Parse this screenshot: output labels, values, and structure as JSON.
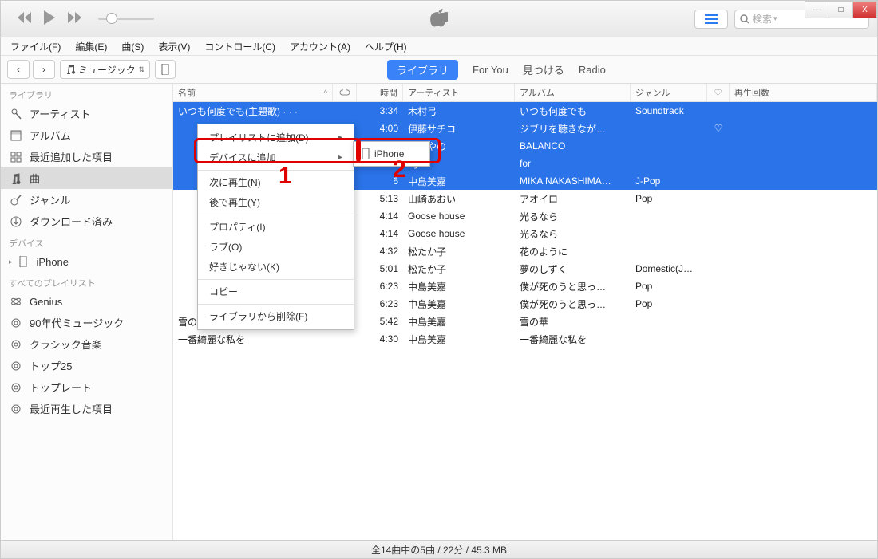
{
  "window_controls": {
    "minimize": "—",
    "maximize": "□",
    "close": "X"
  },
  "menubar": [
    "ファイル(F)",
    "編集(E)",
    "曲(S)",
    "表示(V)",
    "コントロール(C)",
    "アカウント(A)",
    "ヘルプ(H)"
  ],
  "search": {
    "placeholder": "検索"
  },
  "media_selector": {
    "label": "ミュージック",
    "chev": "▾"
  },
  "nav_tabs": {
    "library": "ライブラリ",
    "forYou": "For You",
    "browse": "見つける",
    "radio": "Radio"
  },
  "sidebar": {
    "library_header": "ライブラリ",
    "library_items": [
      {
        "key": "artist",
        "label": "アーティスト"
      },
      {
        "key": "album",
        "label": "アルバム"
      },
      {
        "key": "recent",
        "label": "最近追加した項目"
      },
      {
        "key": "songs",
        "label": "曲",
        "selected": true
      },
      {
        "key": "genre",
        "label": "ジャンル"
      },
      {
        "key": "downloaded",
        "label": "ダウンロード済み"
      }
    ],
    "devices_header": "デバイス",
    "devices": [
      {
        "label": "iPhone"
      }
    ],
    "playlists_header": "すべてのプレイリスト",
    "playlists": [
      {
        "label": "Genius"
      },
      {
        "label": "90年代ミュージック"
      },
      {
        "label": "クラシック音楽"
      },
      {
        "label": "トップ25"
      },
      {
        "label": "トップレート"
      },
      {
        "label": "最近再生した項目"
      }
    ]
  },
  "columns": {
    "name": "名前",
    "time": "時間",
    "artist": "アーティスト",
    "album": "アルバム",
    "genre": "ジャンル",
    "plays": "再生回数"
  },
  "tracks": [
    {
      "sel": true,
      "name": "いつも何度でも(主題歌) · · ·",
      "time": "3:34",
      "artist": "木村弓",
      "album": "いつも何度でも",
      "genre": "Soundtrack"
    },
    {
      "sel": true,
      "name": "",
      "time": "4:00",
      "artist": "伊藤サチコ",
      "album": "ジブリを聴きなが…",
      "genre": "",
      "heart": "♡"
    },
    {
      "sel": true,
      "name": "",
      "time": "",
      "artist": "じあやの",
      "album": "BALANCO",
      "genre": ""
    },
    {
      "sel": true,
      "name": "",
      "time": "",
      "artist": "円",
      "album": "for",
      "genre": ""
    },
    {
      "sel": true,
      "name": "",
      "time": "6",
      "artist": "中島美嘉",
      "album": "MIKA NAKASHIMA…",
      "genre": "J-Pop"
    },
    {
      "sel": false,
      "name": "",
      "time": "5:13",
      "artist": "山崎あおい",
      "album": "アオイロ",
      "genre": "Pop"
    },
    {
      "sel": false,
      "name": "",
      "time": "4:14",
      "artist": "Goose house",
      "album": "光るなら",
      "genre": ""
    },
    {
      "sel": false,
      "name": "",
      "time": "4:14",
      "artist": "Goose house",
      "album": "光るなら",
      "genre": "",
      "ex": true
    },
    {
      "sel": false,
      "name": "",
      "time": "4:32",
      "artist": "松たか子",
      "album": "花のように",
      "genre": ""
    },
    {
      "sel": false,
      "name": "",
      "time": "5:01",
      "artist": "松たか子",
      "album": "夢のしずく",
      "genre": "Domestic(J…"
    },
    {
      "sel": false,
      "name": "",
      "time": "6:23",
      "artist": "中島美嘉",
      "album": "僕が死のうと思っ…",
      "genre": "Pop"
    },
    {
      "sel": false,
      "name": "",
      "time": "6:23",
      "artist": "中島美嘉",
      "album": "僕が死のうと思っ…",
      "genre": "Pop",
      "ex": true
    },
    {
      "sel": false,
      "name": "雪の華",
      "time": "5:42",
      "artist": "中島美嘉",
      "album": "雪の華",
      "genre": ""
    },
    {
      "sel": false,
      "name": "一番綺麗な私を",
      "time": "4:30",
      "artist": "中島美嘉",
      "album": "一番綺麗な私を",
      "genre": ""
    }
  ],
  "context_menu": {
    "add_to_playlist": "プレイリストに追加(D)",
    "add_to_device": "デバイスに追加",
    "play_next": "次に再生(N)",
    "play_later": "後で再生(Y)",
    "properties": "プロパティ(I)",
    "love": "ラブ(O)",
    "dislike": "好きじゃない(K)",
    "copy": "コピー",
    "delete": "ライブラリから削除(F)"
  },
  "submenu": {
    "iphone": "iPhone"
  },
  "annotations": {
    "one": "1",
    "two": "2"
  },
  "status": "全14曲中の5曲 / 22分 / 45.3 MB"
}
